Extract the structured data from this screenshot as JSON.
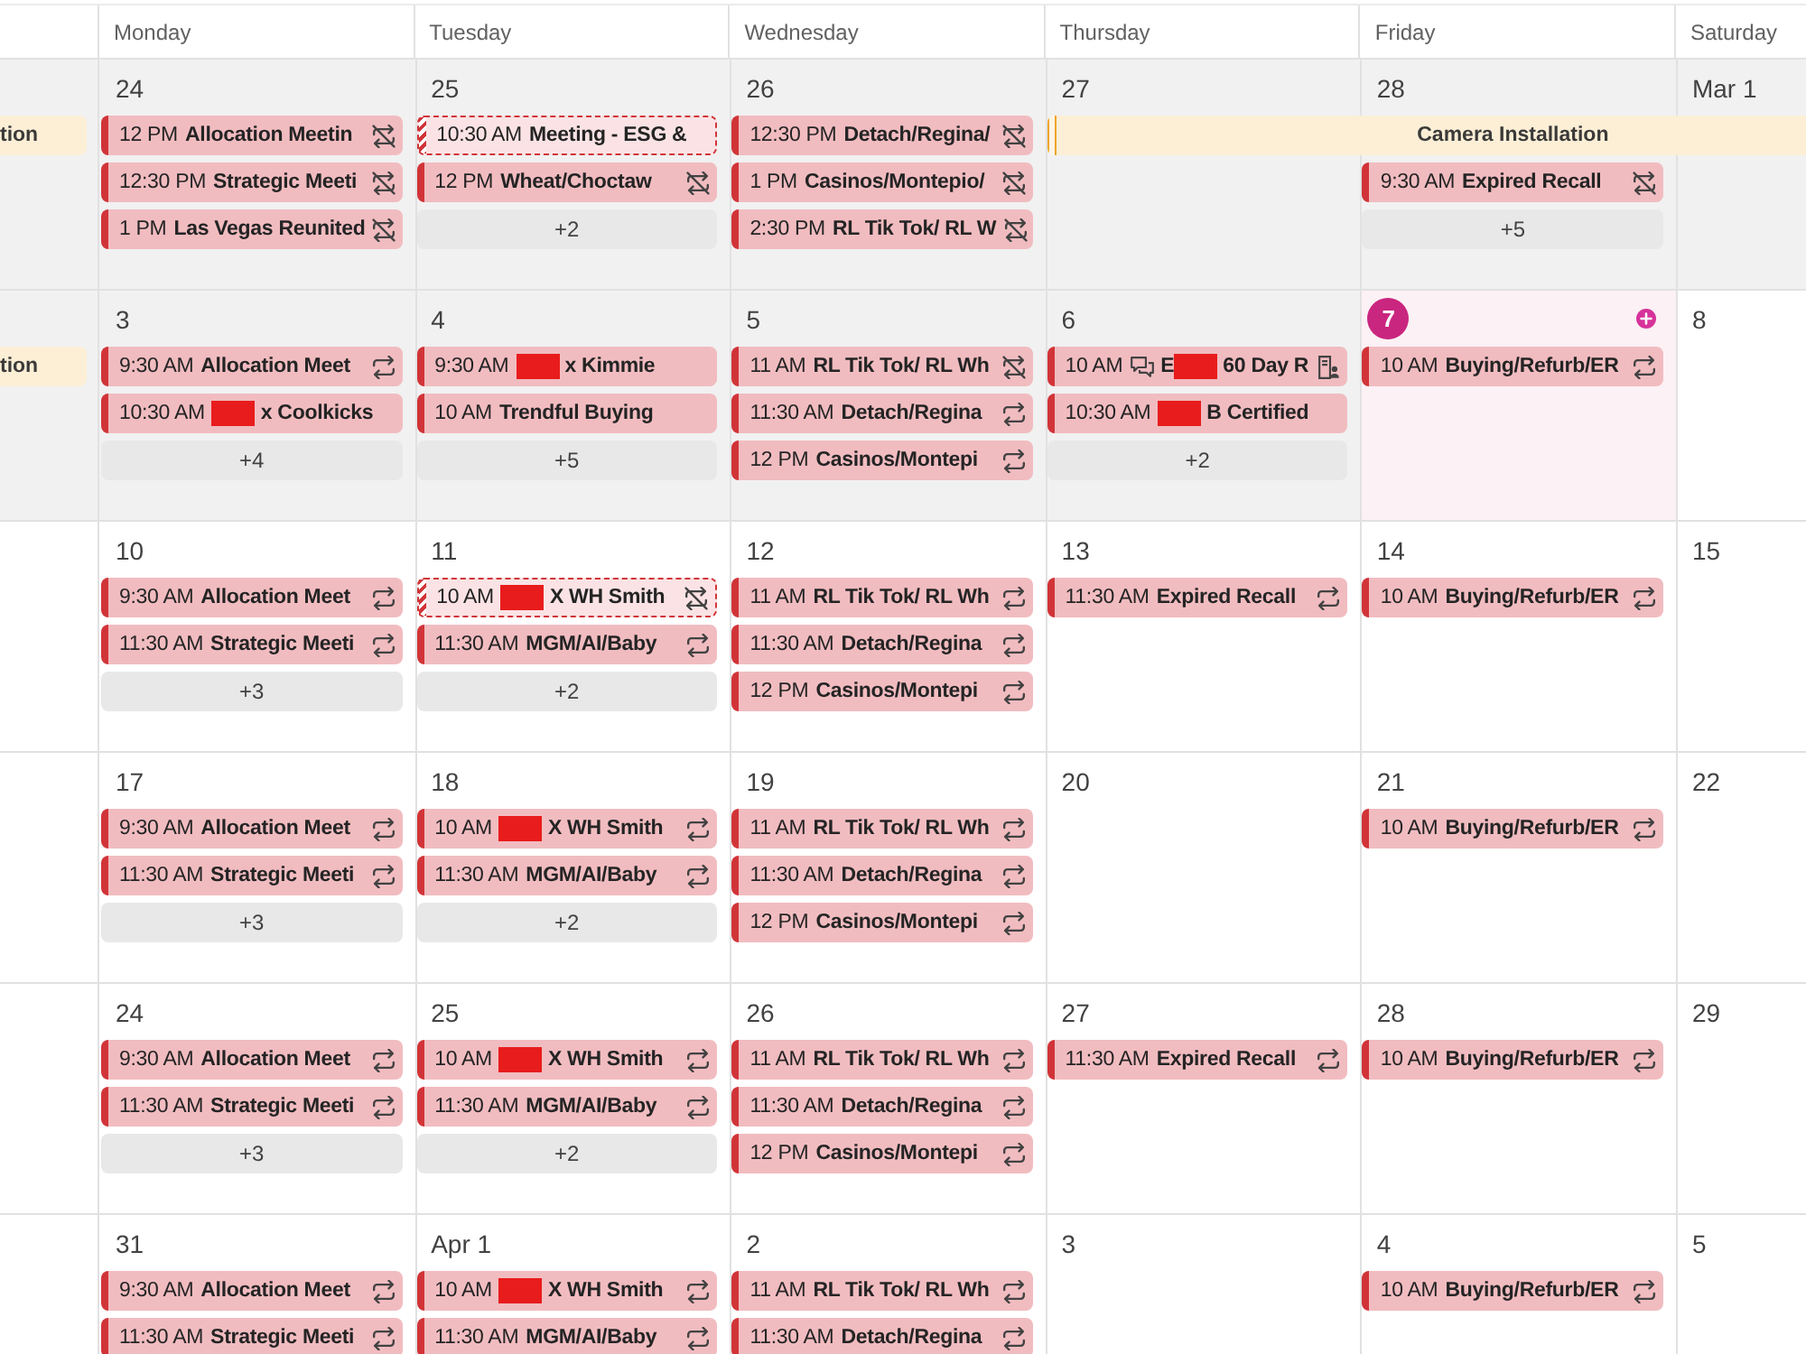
{
  "header": {
    "days": [
      "Monday",
      "Tuesday",
      "Wednesday",
      "Thursday",
      "Friday",
      "Saturday"
    ]
  },
  "weeks": [
    {
      "days": [
        {
          "past": true,
          "today": false,
          "all_day": {
            "title": "tion",
            "continued": true
          }
        },
        {
          "date": "24",
          "past": true,
          "today": false,
          "events": [
            {
              "time": "12 PM",
              "title": "Allocation Meetin",
              "kind": "exception",
              "tentative": false,
              "redacted": false
            },
            {
              "time": "12:30 PM",
              "title": "Strategic Meeti",
              "kind": "exception",
              "tentative": false,
              "redacted": false
            },
            {
              "time": "1 PM",
              "title": "Las Vegas Reunited",
              "kind": "exception",
              "tentative": false,
              "redacted": false
            }
          ]
        },
        {
          "date": "25",
          "past": true,
          "today": false,
          "events": [
            {
              "time": "10:30 AM",
              "title": "Meeting - ESG &",
              "kind": "single",
              "tentative": true,
              "redacted": false
            },
            {
              "time": "12 PM",
              "title": "Wheat/Choctaw",
              "kind": "exception",
              "tentative": false,
              "redacted": false
            }
          ],
          "more": "+2"
        },
        {
          "date": "26",
          "past": true,
          "today": false,
          "events": [
            {
              "time": "12:30 PM",
              "title": "Detach/Regina/",
              "kind": "exception",
              "tentative": false,
              "redacted": false
            },
            {
              "time": "1 PM",
              "title": "Casinos/Montepio/",
              "kind": "exception",
              "tentative": false,
              "redacted": false
            },
            {
              "time": "2:30 PM",
              "title": "RL Tik Tok/ RL W",
              "kind": "exception",
              "tentative": false,
              "redacted": false
            }
          ]
        },
        {
          "date": "27",
          "past": true,
          "today": false,
          "all_day": {
            "title": "Camera Installation",
            "continued": false
          }
        },
        {
          "date": "28",
          "past": true,
          "today": false,
          "all_day_continues": true,
          "events": [
            {
              "time": "9:30 AM",
              "title": "Expired Recall",
              "kind": "exception",
              "tentative": false,
              "redacted": false
            }
          ],
          "more": "+5"
        },
        {
          "date": "Mar 1",
          "past": true,
          "today": false,
          "all_day_continues": true
        }
      ]
    },
    {
      "days": [
        {
          "past": true,
          "today": false,
          "all_day": {
            "title": "tion",
            "continued": true
          }
        },
        {
          "date": "3",
          "past": true,
          "today": false,
          "events": [
            {
              "time": "9:30 AM",
              "title": "Allocation Meet",
              "kind": "recurring",
              "tentative": false,
              "redacted": false
            },
            {
              "time": "10:30 AM",
              "title": "x Coolkicks",
              "kind": "single",
              "tentative": false,
              "redacted": true
            }
          ],
          "more": "+4"
        },
        {
          "date": "4",
          "past": true,
          "today": false,
          "events": [
            {
              "time": "9:30 AM",
              "title": "x Kimmie",
              "kind": "single",
              "tentative": false,
              "redacted": true
            },
            {
              "time": "10 AM",
              "title": "Trendful Buying",
              "kind": "single",
              "tentative": false,
              "redacted": false
            }
          ],
          "more": "+5"
        },
        {
          "date": "5",
          "past": true,
          "today": false,
          "events": [
            {
              "time": "11 AM",
              "title": "RL Tik Tok/ RL Wh",
              "kind": "exception",
              "tentative": false,
              "redacted": false
            },
            {
              "time": "11:30 AM",
              "title": "Detach/Regina",
              "kind": "recurring",
              "tentative": false,
              "redacted": false
            },
            {
              "time": "12 PM",
              "title": "Casinos/Montepi",
              "kind": "recurring",
              "tentative": false,
              "redacted": false
            }
          ]
        },
        {
          "date": "6",
          "past": true,
          "today": false,
          "events": [
            {
              "time": "10 AM",
              "chat": true,
              "title_lead": "E",
              "title": "60 Day R",
              "kind": "document",
              "tentative": false,
              "redacted": true
            },
            {
              "time": "10:30 AM",
              "title": "B Certified",
              "kind": "single",
              "tentative": false,
              "redacted": true
            }
          ],
          "more": "+2"
        },
        {
          "date": "7",
          "past": false,
          "today": true,
          "events": [
            {
              "time": "10 AM",
              "title": "Buying/Refurb/ER",
              "kind": "recurring",
              "tentative": false,
              "redacted": false
            }
          ]
        },
        {
          "date": "8",
          "past": false,
          "today": false
        }
      ]
    },
    {
      "days": [
        {
          "past": false,
          "today": false
        },
        {
          "date": "10",
          "past": false,
          "today": false,
          "events": [
            {
              "time": "9:30 AM",
              "title": "Allocation Meet",
              "kind": "recurring",
              "tentative": false,
              "redacted": false
            },
            {
              "time": "11:30 AM",
              "title": "Strategic Meeti",
              "kind": "recurring",
              "tentative": false,
              "redacted": false
            }
          ],
          "more": "+3"
        },
        {
          "date": "11",
          "past": false,
          "today": false,
          "events": [
            {
              "time": "10 AM",
              "title": "X WH Smith",
              "kind": "exception",
              "tentative": true,
              "redacted": true
            },
            {
              "time": "11:30 AM",
              "title": "MGM/AI/Baby",
              "kind": "recurring",
              "tentative": false,
              "redacted": false
            }
          ],
          "more": "+2"
        },
        {
          "date": "12",
          "past": false,
          "today": false,
          "events": [
            {
              "time": "11 AM",
              "title": "RL Tik Tok/ RL Wh",
              "kind": "recurring",
              "tentative": false,
              "redacted": false
            },
            {
              "time": "11:30 AM",
              "title": "Detach/Regina",
              "kind": "recurring",
              "tentative": false,
              "redacted": false
            },
            {
              "time": "12 PM",
              "title": "Casinos/Montepi",
              "kind": "recurring",
              "tentative": false,
              "redacted": false
            }
          ]
        },
        {
          "date": "13",
          "past": false,
          "today": false,
          "events": [
            {
              "time": "11:30 AM",
              "title": "Expired Recall",
              "kind": "recurring",
              "tentative": false,
              "redacted": false
            }
          ]
        },
        {
          "date": "14",
          "past": false,
          "today": false,
          "events": [
            {
              "time": "10 AM",
              "title": "Buying/Refurb/ER",
              "kind": "recurring",
              "tentative": false,
              "redacted": false
            }
          ]
        },
        {
          "date": "15",
          "past": false,
          "today": false
        }
      ]
    },
    {
      "days": [
        {
          "past": false,
          "today": false
        },
        {
          "date": "17",
          "past": false,
          "today": false,
          "events": [
            {
              "time": "9:30 AM",
              "title": "Allocation Meet",
              "kind": "recurring",
              "tentative": false,
              "redacted": false
            },
            {
              "time": "11:30 AM",
              "title": "Strategic Meeti",
              "kind": "recurring",
              "tentative": false,
              "redacted": false
            }
          ],
          "more": "+3"
        },
        {
          "date": "18",
          "past": false,
          "today": false,
          "events": [
            {
              "time": "10 AM",
              "title": "X WH Smith",
              "kind": "recurring",
              "tentative": false,
              "redacted": true
            },
            {
              "time": "11:30 AM",
              "title": "MGM/AI/Baby",
              "kind": "recurring",
              "tentative": false,
              "redacted": false
            }
          ],
          "more": "+2"
        },
        {
          "date": "19",
          "past": false,
          "today": false,
          "events": [
            {
              "time": "11 AM",
              "title": "RL Tik Tok/ RL Wh",
              "kind": "recurring",
              "tentative": false,
              "redacted": false
            },
            {
              "time": "11:30 AM",
              "title": "Detach/Regina",
              "kind": "recurring",
              "tentative": false,
              "redacted": false
            },
            {
              "time": "12 PM",
              "title": "Casinos/Montepi",
              "kind": "recurring",
              "tentative": false,
              "redacted": false
            }
          ]
        },
        {
          "date": "20",
          "past": false,
          "today": false
        },
        {
          "date": "21",
          "past": false,
          "today": false,
          "events": [
            {
              "time": "10 AM",
              "title": "Buying/Refurb/ER",
              "kind": "recurring",
              "tentative": false,
              "redacted": false
            }
          ]
        },
        {
          "date": "22",
          "past": false,
          "today": false
        }
      ]
    },
    {
      "days": [
        {
          "past": false,
          "today": false
        },
        {
          "date": "24",
          "past": false,
          "today": false,
          "events": [
            {
              "time": "9:30 AM",
              "title": "Allocation Meet",
              "kind": "recurring",
              "tentative": false,
              "redacted": false
            },
            {
              "time": "11:30 AM",
              "title": "Strategic Meeti",
              "kind": "recurring",
              "tentative": false,
              "redacted": false
            }
          ],
          "more": "+3"
        },
        {
          "date": "25",
          "past": false,
          "today": false,
          "events": [
            {
              "time": "10 AM",
              "title": "X WH Smith",
              "kind": "recurring",
              "tentative": false,
              "redacted": true
            },
            {
              "time": "11:30 AM",
              "title": "MGM/AI/Baby",
              "kind": "recurring",
              "tentative": false,
              "redacted": false
            }
          ],
          "more": "+2"
        },
        {
          "date": "26",
          "past": false,
          "today": false,
          "events": [
            {
              "time": "11 AM",
              "title": "RL Tik Tok/ RL Wh",
              "kind": "recurring",
              "tentative": false,
              "redacted": false
            },
            {
              "time": "11:30 AM",
              "title": "Detach/Regina",
              "kind": "recurring",
              "tentative": false,
              "redacted": false
            },
            {
              "time": "12 PM",
              "title": "Casinos/Montepi",
              "kind": "recurring",
              "tentative": false,
              "redacted": false
            }
          ]
        },
        {
          "date": "27",
          "past": false,
          "today": false,
          "events": [
            {
              "time": "11:30 AM",
              "title": "Expired Recall",
              "kind": "recurring",
              "tentative": false,
              "redacted": false
            }
          ]
        },
        {
          "date": "28",
          "past": false,
          "today": false,
          "events": [
            {
              "time": "10 AM",
              "title": "Buying/Refurb/ER",
              "kind": "recurring",
              "tentative": false,
              "redacted": false
            }
          ]
        },
        {
          "date": "29",
          "past": false,
          "today": false
        }
      ]
    },
    {
      "days": [
        {
          "past": false,
          "today": false
        },
        {
          "date": "31",
          "past": false,
          "today": false,
          "events": [
            {
              "time": "9:30 AM",
              "title": "Allocation Meet",
              "kind": "recurring",
              "tentative": false,
              "redacted": false
            },
            {
              "time": "11:30 AM",
              "title": "Strategic Meeti",
              "kind": "recurring",
              "tentative": false,
              "redacted": false
            }
          ]
        },
        {
          "date": "Apr 1",
          "past": false,
          "today": false,
          "events": [
            {
              "time": "10 AM",
              "title": "X WH Smith",
              "kind": "recurring",
              "tentative": false,
              "redacted": true
            },
            {
              "time": "11:30 AM",
              "title": "MGM/AI/Baby",
              "kind": "recurring",
              "tentative": false,
              "redacted": false
            }
          ]
        },
        {
          "date": "2",
          "past": false,
          "today": false,
          "events": [
            {
              "time": "11 AM",
              "title": "RL Tik Tok/ RL Wh",
              "kind": "recurring",
              "tentative": false,
              "redacted": false
            },
            {
              "time": "11:30 AM",
              "title": "Detach/Regina",
              "kind": "recurring",
              "tentative": false,
              "redacted": false
            }
          ]
        },
        {
          "date": "3",
          "past": false,
          "today": false
        },
        {
          "date": "4",
          "past": false,
          "today": false,
          "events": [
            {
              "time": "10 AM",
              "title": "Buying/Refurb/ER",
              "kind": "recurring",
              "tentative": false,
              "redacted": false
            }
          ]
        },
        {
          "date": "5",
          "past": false,
          "today": false
        }
      ]
    }
  ]
}
